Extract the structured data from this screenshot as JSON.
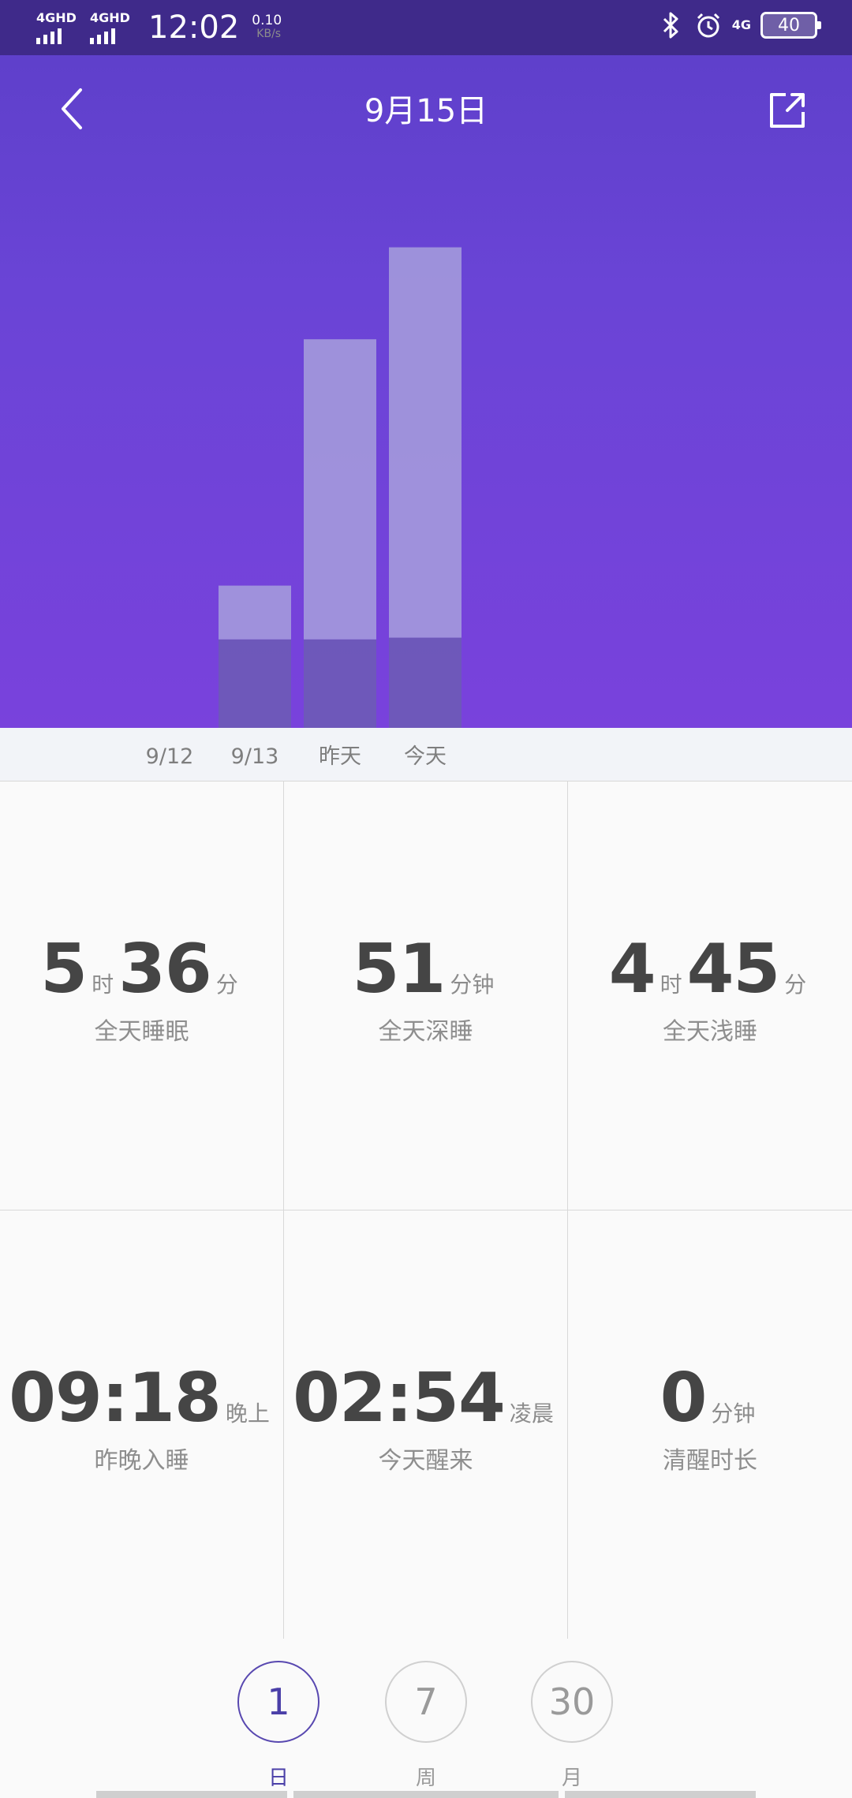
{
  "status_bar": {
    "net1": "4GHD",
    "net2": "4GHD",
    "time": "12:02",
    "speed_value": "0.10",
    "speed_unit": "KB/s",
    "signal_right": "4G",
    "battery": "40",
    "icons": [
      "bluetooth-icon",
      "alarm-icon"
    ]
  },
  "header": {
    "title": "9月15日",
    "back_icon": "chevron-left-icon",
    "share_icon": "share-icon"
  },
  "chart_data": {
    "type": "bar",
    "stacked": true,
    "categories": [
      "9/12",
      "9/13",
      "昨天",
      "今天"
    ],
    "series": [
      {
        "values": [
          0,
          51,
          51,
          52
        ],
        "color": "#6c5cb4"
      },
      {
        "values": [
          0,
          31,
          173,
          225
        ],
        "color": "#a79fdc"
      }
    ],
    "colors": {
      "deep_sleep": "#5d4fa4",
      "light_sleep": "#a89fdb"
    },
    "grid": false
  },
  "stats": [
    {
      "parts": [
        {
          "num": "5"
        },
        {
          "unit": "时"
        },
        {
          "num": "36"
        },
        {
          "unit": "分"
        }
      ],
      "label": "全天睡眠"
    },
    {
      "parts": [
        {
          "num": "51"
        },
        {
          "unit": "分钟"
        }
      ],
      "label": "全天深睡"
    },
    {
      "parts": [
        {
          "num": "4"
        },
        {
          "unit": "时"
        },
        {
          "num": "45"
        },
        {
          "unit": "分"
        }
      ],
      "label": "全天浅睡"
    },
    {
      "parts": [
        {
          "num": "09:18"
        },
        {
          "unit": "晚上"
        }
      ],
      "label": "昨晚入睡"
    },
    {
      "parts": [
        {
          "num": "02:54"
        },
        {
          "unit": "凌晨"
        }
      ],
      "label": "今天醒来"
    },
    {
      "parts": [
        {
          "num": "0"
        },
        {
          "unit": "分钟"
        }
      ],
      "label": "清醒时长"
    }
  ],
  "range_selector": [
    {
      "value": "1",
      "label": "日",
      "active": true
    },
    {
      "value": "7",
      "label": "周",
      "active": false
    },
    {
      "value": "30",
      "label": "月",
      "active": false
    }
  ]
}
